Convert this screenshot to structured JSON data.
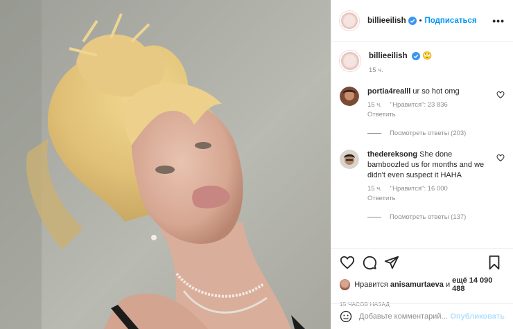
{
  "header": {
    "username": "billieeilish",
    "separator": "•",
    "follow_label": "Подписаться",
    "more_label": "•••"
  },
  "caption": {
    "username": "billieeilish",
    "emoji": "🙄",
    "time": "15 ч."
  },
  "comments": [
    {
      "username": "portia4realll",
      "text": "ur so hot omg",
      "time": "15 ч.",
      "likes": "\"Нравится\": 23 836",
      "reply_label": "Ответить",
      "thread_label": "Посмотреть ответы (203)"
    },
    {
      "username": "thedereksong",
      "text": "She done bamboozled us for months and we didn't even suspect it HAHA",
      "time": "15 ч.",
      "likes": "\"Нравится\": 16 000",
      "reply_label": "Ответить",
      "thread_label": "Посмотреть ответы (137)"
    }
  ],
  "likes_line": {
    "prefix": "Нравится",
    "user": "anisamurtaeva",
    "middle": "и",
    "rest": "ещё 14 090 488"
  },
  "timestamp": "15 ЧАСОВ НАЗАД",
  "comment_box": {
    "placeholder": "Добавьте комментарий...",
    "publish_label": "Опубликовать"
  },
  "colors": {
    "accent": "#0095f6",
    "publish_disabled": "#b2dffc",
    "muted": "#8e8e8e"
  },
  "icons": [
    "verified-badge-icon",
    "heart-icon",
    "comment-icon",
    "share-icon",
    "bookmark-icon",
    "emoji-icon",
    "more-icon"
  ]
}
